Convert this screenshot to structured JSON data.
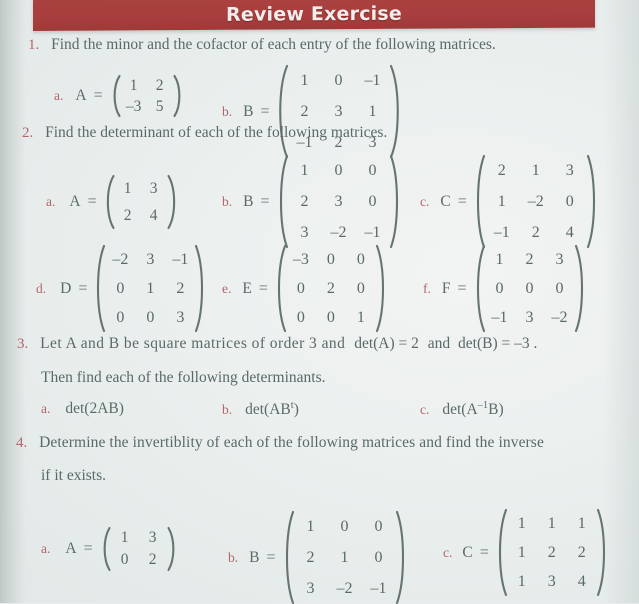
{
  "header": {
    "title": "Review Exercise",
    "banner_color": "#a93e3e",
    "title_color": "#f0eeec"
  },
  "theme": {
    "paper": "#e9eeed",
    "body_text": "#5a6a6a",
    "marker_red": "#b4656a"
  },
  "questions": [
    {
      "number": "1.",
      "stem": "Find the minor and the cofactor of each entry of the following matrices.",
      "items": [
        {
          "letter": "a.",
          "name": "A",
          "eq": "=",
          "rows": [
            [
              "1",
              "2"
            ],
            [
              "–3",
              "5"
            ]
          ]
        },
        {
          "letter": "b.",
          "name": "B",
          "eq": "=",
          "rows": [
            [
              "1",
              "0",
              "–1"
            ],
            [
              "2",
              "3",
              "1"
            ],
            [
              "–1",
              "2",
              "3"
            ]
          ]
        }
      ]
    },
    {
      "number": "2.",
      "stem": "Find the determinant of each of the following matrices.",
      "items": [
        {
          "letter": "a.",
          "name": "A",
          "eq": "=",
          "rows": [
            [
              "1",
              "3"
            ],
            [
              "2",
              "4"
            ]
          ]
        },
        {
          "letter": "b.",
          "name": "B",
          "eq": "=",
          "rows": [
            [
              "1",
              "0",
              "0"
            ],
            [
              "2",
              "3",
              "0"
            ],
            [
              "3",
              "–2",
              "–1"
            ]
          ]
        },
        {
          "letter": "c.",
          "name": "C",
          "eq": "=",
          "rows": [
            [
              "2",
              "1",
              "3"
            ],
            [
              "1",
              "–2",
              "0"
            ],
            [
              "–1",
              "2",
              "4"
            ]
          ]
        },
        {
          "letter": "d.",
          "name": "D",
          "eq": "=",
          "rows": [
            [
              "–2",
              "3",
              "–1"
            ],
            [
              "0",
              "1",
              "2"
            ],
            [
              "0",
              "0",
              "3"
            ]
          ]
        },
        {
          "letter": "e.",
          "name": "E",
          "eq": "=",
          "rows": [
            [
              "–3",
              "0",
              "0"
            ],
            [
              "0",
              "2",
              "0"
            ],
            [
              "0",
              "0",
              "1"
            ]
          ]
        },
        {
          "letter": "f.",
          "name": "F",
          "eq": "=",
          "rows": [
            [
              "1",
              "2",
              "3"
            ],
            [
              "0",
              "0",
              "0"
            ],
            [
              "–1",
              "3",
              "–2"
            ]
          ]
        }
      ]
    },
    {
      "number": "3.",
      "stem_line1": "Let A and B be square matrices of order 3 and",
      "stem_detA": "det(A) = 2",
      "stem_and": "and",
      "stem_detB": "det(B) = –3 .",
      "stem_line2": "Then find each of the following determinants.",
      "items": [
        {
          "letter": "a.",
          "expr": "det(2AB)"
        },
        {
          "letter": "b.",
          "expr_base": "det(AB",
          "expr_sup": "t",
          "expr_tail": ")"
        },
        {
          "letter": "c.",
          "expr_base": "det(A",
          "expr_sup": "–1",
          "expr_tail": "B)"
        }
      ]
    },
    {
      "number": "4.",
      "stem_line1": "Determine the invertiblity of each of the following matrices and find the inverse",
      "stem_line2": "if it exists.",
      "items": [
        {
          "letter": "a.",
          "name": "A",
          "eq": "=",
          "rows": [
            [
              "1",
              "3"
            ],
            [
              "0",
              "2"
            ]
          ]
        },
        {
          "letter": "b.",
          "name": "B",
          "eq": "=",
          "rows": [
            [
              "1",
              "0",
              "0"
            ],
            [
              "2",
              "1",
              "0"
            ],
            [
              "3",
              "–2",
              "–1"
            ]
          ]
        },
        {
          "letter": "c.",
          "name": "C",
          "eq": "=",
          "rows": [
            [
              "1",
              "1",
              "1"
            ],
            [
              "1",
              "2",
              "2"
            ],
            [
              "1",
              "3",
              "4"
            ]
          ]
        }
      ]
    }
  ]
}
